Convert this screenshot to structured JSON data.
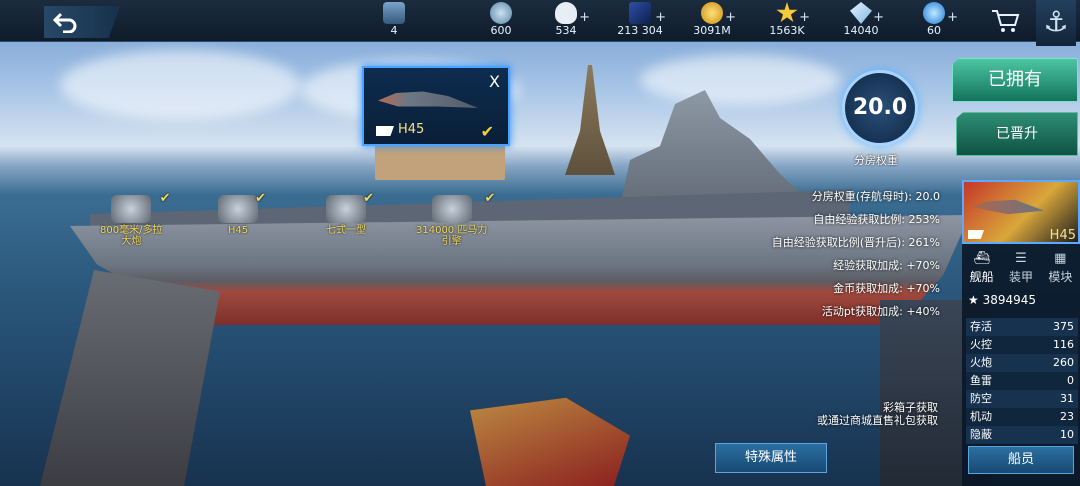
{
  "topbar": {
    "resources": [
      {
        "icon": "rank-badge-icon",
        "value": "4",
        "plus": false
      },
      {
        "icon": "ship-wheel-icon",
        "value": "600",
        "plus": false
      },
      {
        "icon": "heart-icon",
        "value": "534",
        "plus": true
      },
      {
        "icon": "card-icon",
        "value": "213 304",
        "plus": true
      },
      {
        "icon": "gold-coin-icon",
        "value": "3091M",
        "plus": true
      },
      {
        "icon": "star-icon",
        "value": "1563K",
        "plus": true
      },
      {
        "icon": "diamond-wing-icon",
        "value": "14040",
        "plus": true
      },
      {
        "icon": "blue-gem-icon",
        "value": "60",
        "plus": true
      }
    ]
  },
  "popup": {
    "ship_name": "H45",
    "close": "X"
  },
  "equipment": [
    {
      "label": "800毫米/多拉\n大炮"
    },
    {
      "label": "H45"
    },
    {
      "label": "七式一型"
    },
    {
      "label": "314000 匹马力\n引擎"
    }
  ],
  "score": {
    "value": "20.0",
    "label": "分房权重"
  },
  "stats": [
    "分房权重(存航母时): 20.0",
    "自由经验获取比例: 253%",
    "自由经验获取比例(晋升后): 261%",
    "经验获取加成: +70%",
    "金币获取加成: +70%",
    "活动pt获取加成: +40%"
  ],
  "buttons": {
    "owned": "已拥有",
    "promoted": "已晋升",
    "special": "特殊属性",
    "crew": "船员"
  },
  "acquire_note": "彩箱子获取\n或通过商城直售礼包获取",
  "card": {
    "name": "H45"
  },
  "tabs": [
    {
      "label": "舰船",
      "icon": "ship-icon"
    },
    {
      "label": "装甲",
      "icon": "armor-icon"
    },
    {
      "label": "模块",
      "icon": "module-icon"
    }
  ],
  "rating": "3894945",
  "attributes": [
    {
      "k": "存活",
      "v": "375"
    },
    {
      "k": "火控",
      "v": "116"
    },
    {
      "k": "火炮",
      "v": "260"
    },
    {
      "k": "鱼雷",
      "v": "0"
    },
    {
      "k": "防空",
      "v": "31"
    },
    {
      "k": "机动",
      "v": "23"
    },
    {
      "k": "隐蔽",
      "v": "10"
    }
  ],
  "colors": {
    "accent": "#4aa3ff",
    "gold": "#f3d95c",
    "green": "#2ea884"
  }
}
